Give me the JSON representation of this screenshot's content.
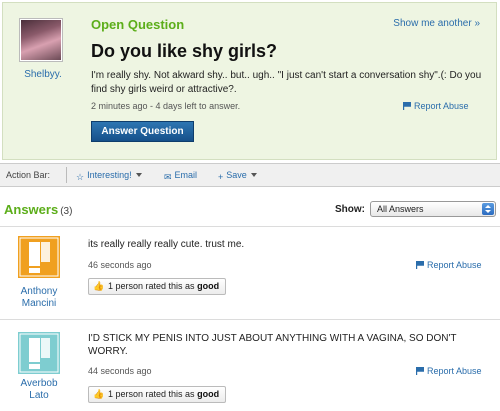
{
  "question": {
    "asker_name": "Shelbyy.",
    "status": "Open Question",
    "show_another": "Show me another »",
    "title": "Do you like shy girls?",
    "body": "I'm really shy. Not akward shy.. but.. ugh.. \"I just can't start a conversation shy\".(: Do you find shy girls weird or attractive?.",
    "meta": "2 minutes ago - 4 days left to answer.",
    "report": "Report Abuse",
    "answer_button": "Answer Question"
  },
  "action_bar": {
    "label": "Action Bar:",
    "interesting": "Interesting!",
    "email": "Email",
    "save": "Save"
  },
  "answers_header": {
    "title": "Answers",
    "count": "(3)",
    "show_label": "Show:",
    "show_value": "All Answers"
  },
  "answers": [
    {
      "name_line1": "Anthony",
      "name_line2": "Mancini",
      "avatar_color": "#f0a020",
      "text": "its really really really cute. trust me.",
      "meta": "46 seconds ago",
      "report": "Report Abuse",
      "rating_prefix": "1 person rated this as",
      "rating_word": "good"
    },
    {
      "name_line1": "Averbob",
      "name_line2": "Lato",
      "avatar_color": "#7ecdd0",
      "text": "I'D STICK MY PENIS INTO JUST ABOUT ANYTHING WITH A VAGINA, SO DON'T WORRY.",
      "meta": "44 seconds ago",
      "report": "Report Abuse",
      "rating_prefix": "1 person rated this as",
      "rating_word": "good"
    }
  ],
  "colors": {
    "accent_green": "#5cae1a",
    "link_blue": "#2a6dab",
    "card_bg": "#eef5e2"
  }
}
